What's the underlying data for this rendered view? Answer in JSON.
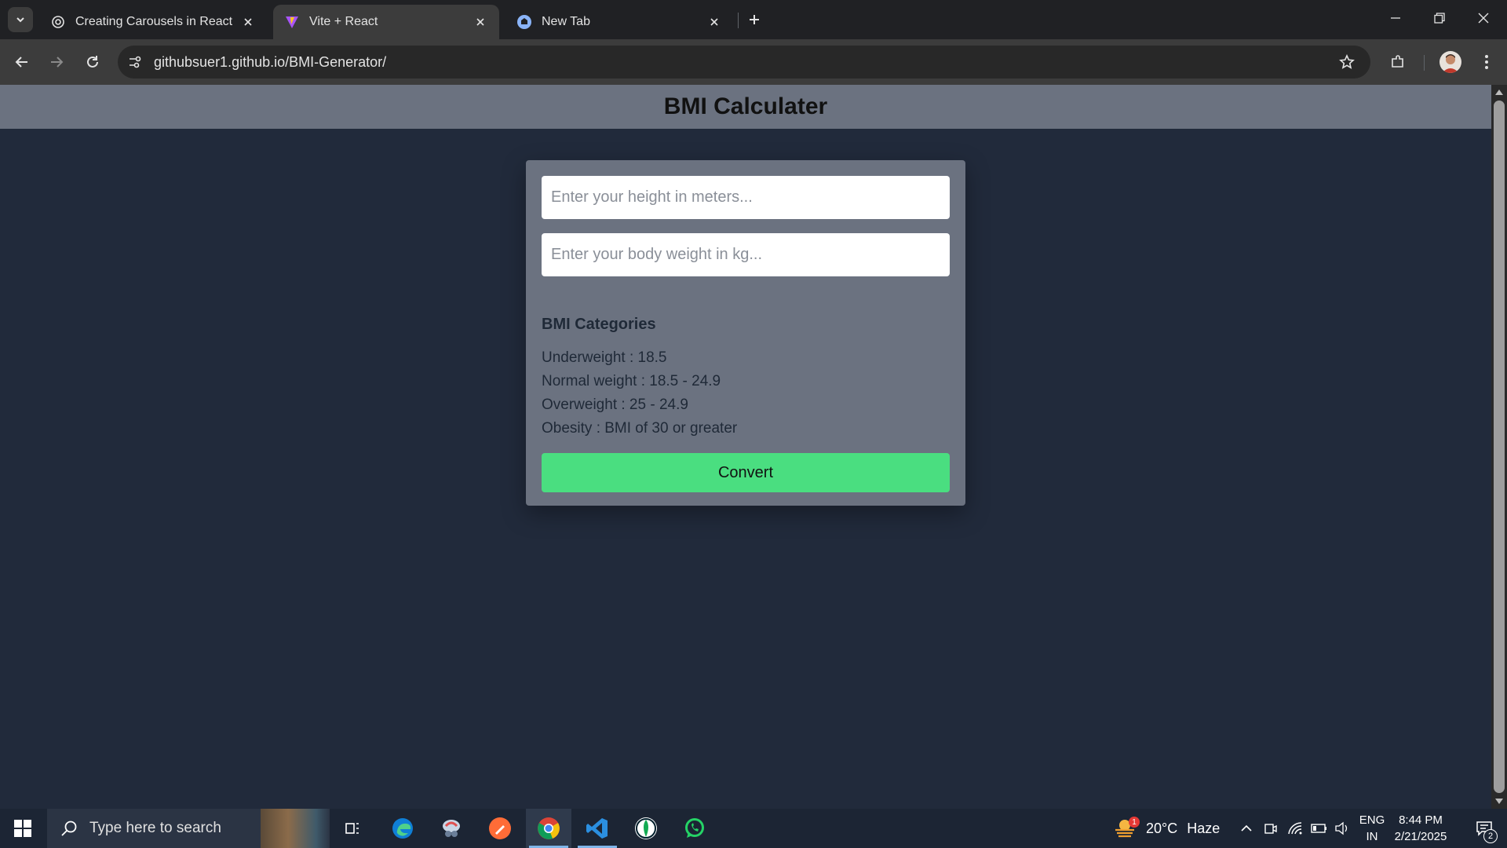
{
  "browser": {
    "tabs": [
      {
        "title": "Creating Carousels in React",
        "active": false,
        "favicon": "openai-icon"
      },
      {
        "title": "Vite + React",
        "active": true,
        "favicon": "vite-icon"
      },
      {
        "title": "New Tab",
        "active": false,
        "favicon": "chrome-newtab-icon"
      }
    ],
    "url": "githubsuer1.github.io/BMI-Generator/"
  },
  "app": {
    "title": "BMI Calculater",
    "height_placeholder": "Enter your height in meters...",
    "weight_placeholder": "Enter your body weight in kg...",
    "height_value": "",
    "weight_value": "",
    "categories_heading": "BMI Categories",
    "categories": [
      "Underweight : 18.5",
      "Normal weight : 18.5 - 24.9",
      "Overweight : 25 - 24.9",
      "Obesity : BMI of 30 or greater"
    ],
    "convert_label": "Convert"
  },
  "taskbar": {
    "search_placeholder": "Type here to search",
    "apps": [
      "task-view",
      "edge",
      "snipping",
      "postman",
      "chrome",
      "vscode",
      "mongodb-compass",
      "whatsapp"
    ],
    "weather": {
      "temp": "20°C",
      "condition": "Haze",
      "badge": "1"
    },
    "language": {
      "line1": "ENG",
      "line2": "IN"
    },
    "time": "8:44 PM",
    "date": "2/21/2025",
    "notifications": "2"
  },
  "colors": {
    "page_bg": "#212a3b",
    "header_bg": "#6b7280",
    "card_bg": "#6b7280",
    "button_bg": "#4ade80"
  }
}
